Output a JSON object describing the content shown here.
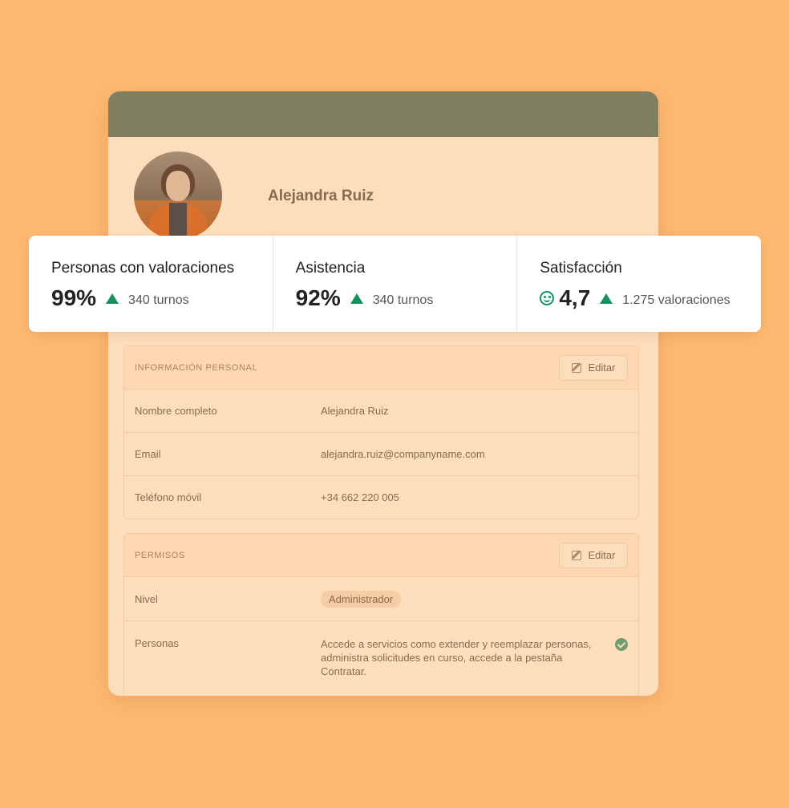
{
  "profile": {
    "name": "Alejandra Ruiz"
  },
  "stats": [
    {
      "label": "Personas con valoraciones",
      "value": "99%",
      "sub": "340 turnos",
      "icon": "arrow-up-icon"
    },
    {
      "label": "Asistencia",
      "value": "92%",
      "sub": "340 turnos",
      "icon": "arrow-up-icon"
    },
    {
      "label": "Satisfacción",
      "value": "4,7",
      "sub": "1.275 valoraciones",
      "icon": "smile-icon"
    }
  ],
  "personal": {
    "title": "INFORMACIÓN PERSONAL",
    "edit_label": "Editar",
    "rows": [
      {
        "key": "Nombre completo",
        "value": "Alejandra Ruiz"
      },
      {
        "key": "Email",
        "value": "alejandra.ruiz@companyname.com"
      },
      {
        "key": "Teléfono móvil",
        "value": "+34 662 220 005"
      }
    ]
  },
  "permissions": {
    "title": "PERMISOS",
    "edit_label": "Editar",
    "level_key": "Nivel",
    "level_value": "Administrador",
    "people_key": "Personas",
    "people_value": "Accede a servicios como extender y reemplazar personas, administra solicitudes en curso, accede a la pestaña Contratar."
  },
  "colors": {
    "background": "#FDB871",
    "header": "#808060",
    "card": "#FDDEBC",
    "accent_green": "#10945F"
  }
}
